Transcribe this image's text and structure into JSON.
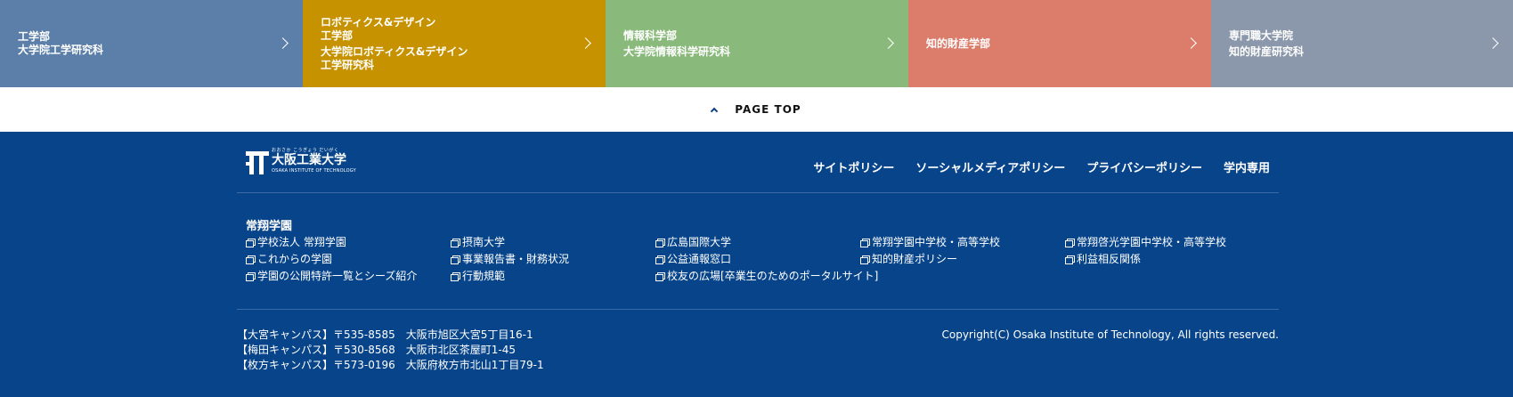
{
  "faculties": [
    {
      "lines": [
        "工学部",
        "大学院工学研究科"
      ],
      "color": "#5b7fa8"
    },
    {
      "lines": [
        "ロボティクス&デザイン",
        "工学部",
        "大学院ロボティクス&デザイン",
        "工学研究科"
      ],
      "color": "#c79200"
    },
    {
      "lines": [
        "情報科学部",
        "大学院情報科学研究科"
      ],
      "color": "#8aba7b"
    },
    {
      "lines": [
        "知的財産学部"
      ],
      "color": "#dc7d6c"
    },
    {
      "lines": [
        "専門職大学院",
        "知的財産研究科"
      ],
      "color": "#8b97aa"
    }
  ],
  "page_top": {
    "label": "PAGE TOP"
  },
  "logo": {
    "ruby": "おおさか こうぎょう だいがく",
    "name": "大阪工業大学",
    "english": "OSAKA INSTITUTE OF TECHNOLOGY"
  },
  "policy_nav": [
    "サイトポリシー",
    "ソーシャルメディアポリシー",
    "プライバシーポリシー",
    "学内専用"
  ],
  "group": {
    "title": "常翔学園",
    "links": [
      "学校法人 常翔学園",
      "摂南大学",
      "広島国際大学",
      "常翔学園中学校・高等学校",
      "常翔啓光学園中学校・高等学校",
      "これからの学園",
      "事業報告書・財務状況",
      "公益通報窓口",
      "知的財産ポリシー",
      "利益相反関係",
      "学園の公開特許一覧とシーズ紹介",
      "行動規範",
      "校友の広場[卒業生のためのポータルサイト]"
    ]
  },
  "addresses": [
    "【大宮キャンパス】〒535-8585　大阪市旭区大宮5丁目16-1",
    "【梅田キャンパス】〒530-8568　大阪市北区茶屋町1-45",
    "【枚方キャンパス】〒573-0196　大阪府枚方市北山1丁目79-1"
  ],
  "copyright": "Copyright(C) Osaka Institute of Technology, All rights reserved.",
  "colors": {
    "footer_bg": "#07448a",
    "page_top_bg": "#ffffff"
  }
}
